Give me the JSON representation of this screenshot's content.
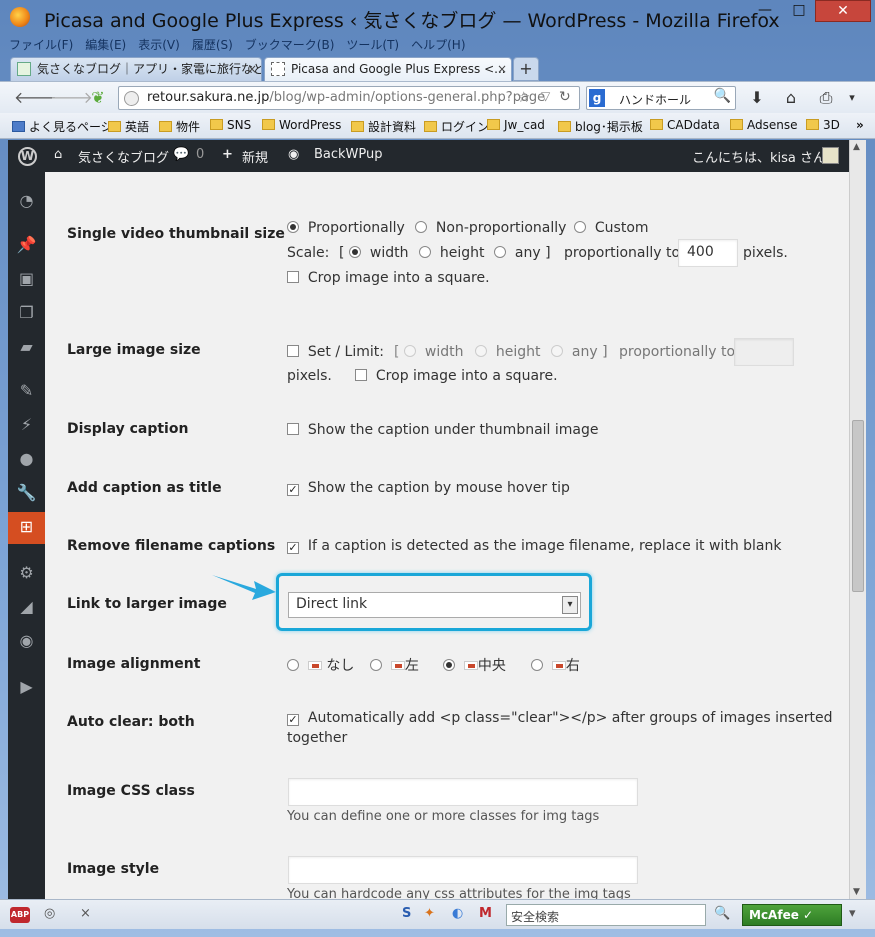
{
  "window": {
    "title": "Picasa and Google Plus Express ‹ 気さくなブログ — WordPress - Mozilla Firefox",
    "controls": {
      "minimize": "—",
      "maximize": "□",
      "close": "✕"
    }
  },
  "menu": [
    "ファイル(F)",
    "編集(E)",
    "表示(V)",
    "履歴(S)",
    "ブックマーク(B)",
    "ツール(T)",
    "ヘルプ(H)"
  ],
  "tabs": [
    {
      "label": "気さくなブログ｜アプリ・家電に旅行などな...",
      "close": "×"
    },
    {
      "label": "Picasa and Google Plus Express <...",
      "close": "×"
    }
  ],
  "newtab": "+",
  "nav": {
    "url_host": "retour.sakura.ne.jp",
    "url_path": "/blog/wp-admin/options-general.php?page",
    "search_engine": "g",
    "search_value": "ハンドホール"
  },
  "bookmarks": [
    "よく見るページ",
    "英語",
    "物件",
    "SNS",
    "WordPress",
    "設計資料",
    "ログイン",
    "Jw_cad",
    "blog･掲示板",
    "CADdata",
    "Adsense",
    "3D"
  ],
  "adminbar": {
    "site": "気さくなブログ",
    "comments": "0",
    "new": "新規",
    "backwpup": "BackWPup",
    "greeting": "こんにちは、kisa さん！"
  },
  "settings": {
    "single_video": {
      "label": "Single video thumbnail size",
      "opt1": "Proportionally",
      "opt2": "Non-proportionally",
      "opt3": "Custom",
      "scale": "Scale:",
      "bracket_open": "[",
      "width": "width",
      "height": "height",
      "any": "any ]",
      "prop_to": "proportionally to",
      "value": "400",
      "pixels": "pixels.",
      "crop": "Crop image into a square."
    },
    "large_image": {
      "label": "Large image size",
      "set_limit": "Set / Limit:",
      "bracket_open": "[",
      "width": "width",
      "height": "height",
      "any": "any ]",
      "prop_to": "proportionally to",
      "pixels": "pixels.",
      "crop": "Crop image into a square."
    },
    "display_caption": {
      "label": "Display caption",
      "option": "Show the caption under thumbnail image"
    },
    "caption_title": {
      "label": "Add caption as title",
      "option": "Show the caption by mouse hover tip"
    },
    "remove_filename": {
      "label": "Remove filename captions",
      "option": "If a caption is detected as the image filename, replace it with blank"
    },
    "link_larger": {
      "label": "Link to larger image",
      "selected": "Direct link"
    },
    "alignment": {
      "label": "Image alignment",
      "opts": [
        "なし",
        "左",
        "中央",
        "右"
      ]
    },
    "auto_clear": {
      "label": "Auto clear: both",
      "option_line1": "Automatically add <p class=\"clear\"></p> after groups of images inserted",
      "option_line2": "together"
    },
    "css_class": {
      "label": "Image CSS class",
      "hint": "You can define one or more classes for img tags"
    },
    "image_style": {
      "label": "Image style",
      "hint": "You can hardcode any css attributes for the img tags"
    }
  },
  "addonbar": {
    "abp": "ABP",
    "search_placeholder": "安全検索",
    "mcafee": "McAfee"
  },
  "colors": {
    "accent_highlight": "#1aa7d8",
    "wp_admin_bar": "#23282d",
    "active_menu": "#d54e21"
  }
}
